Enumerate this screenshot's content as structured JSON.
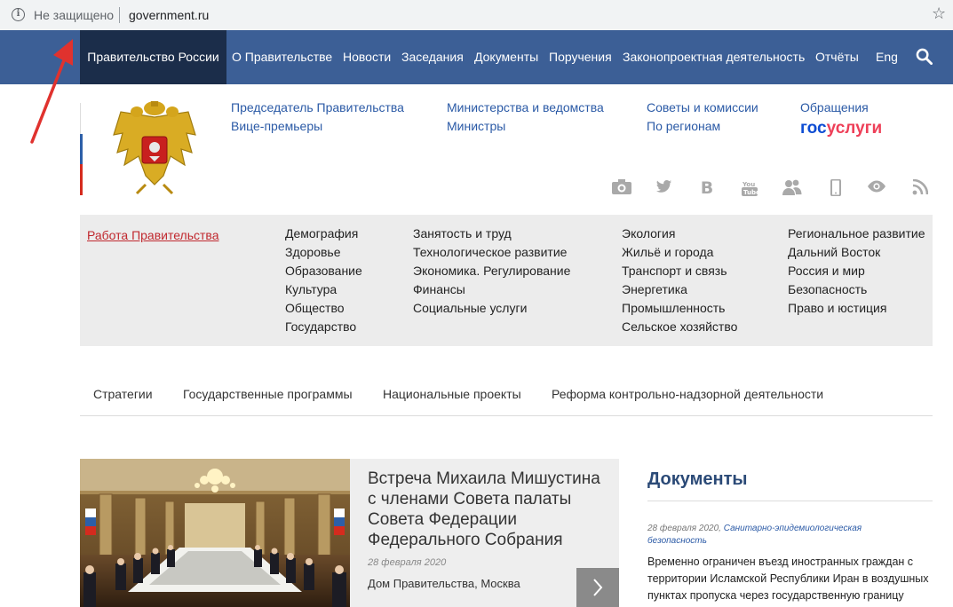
{
  "browser": {
    "security_label": "Не защищено",
    "url": "government.ru",
    "info_icon": "info-icon",
    "bookmark_icon": "star-icon"
  },
  "topnav": {
    "home": "Правительство России",
    "items": [
      "О Правительстве",
      "Новости",
      "Заседания",
      "Документы",
      "Поручения",
      "Законопроектная деятельность",
      "Отчёты",
      "Eng"
    ],
    "search_icon": "search-icon",
    "bg_color": "#3c5f96",
    "active_color": "#1b2d4a"
  },
  "header_links": {
    "col1": [
      "Председатель Правительства",
      "Вице-премьеры"
    ],
    "col2": [
      "Министерства и ведомства",
      "Министры"
    ],
    "col3": [
      "Советы и комиссии",
      "По регионам"
    ],
    "col4": [
      "Обращения"
    ]
  },
  "gosuslugi": {
    "part1": "гос",
    "part2": "услуги"
  },
  "social_icons": [
    "camera-icon",
    "twitter-icon",
    "vk-icon",
    "youtube-icon",
    "users-icon",
    "mobile-icon",
    "eye-icon",
    "rss-icon"
  ],
  "topics": {
    "work_link": "Работа Правительства",
    "col1": [
      "Демография",
      "Здоровье",
      "Образование",
      "Культура",
      "Общество",
      "Государство"
    ],
    "col2": [
      "Занятость и труд",
      "Технологическое развитие",
      "Экономика. Регулирование",
      "Финансы",
      "Социальные услуги"
    ],
    "col3": [
      "Экология",
      "Жильё и города",
      "Транспорт и связь",
      "Энергетика",
      "Промышленность",
      "Сельское хозяйство"
    ],
    "col4": [
      "Региональное развитие",
      "Дальний Восток",
      "Россия и мир",
      "Безопасность",
      "Право и юстиция"
    ]
  },
  "subnav": [
    "Стратегии",
    "Государственные программы",
    "Национальные проекты",
    "Реформа контрольно-надзорной деятельности"
  ],
  "news": {
    "title": "Встреча Михаила Мишустина с членами Совета палаты Совета Федерации Федерального Собрания",
    "date": "28 февраля 2020",
    "place": "Дом Правительства, Москва",
    "next_icon": "chevron-right-icon"
  },
  "documents": {
    "title": "Документы",
    "date": "28 февраля 2020,",
    "category": "Санитарно-эпидемиологическая безопасность",
    "text": "Временно ограничен въезд иностранных граждан с территории Исламской Республики Иран в воздушных пунктах пропуска через государственную границу Российской Федерации"
  }
}
